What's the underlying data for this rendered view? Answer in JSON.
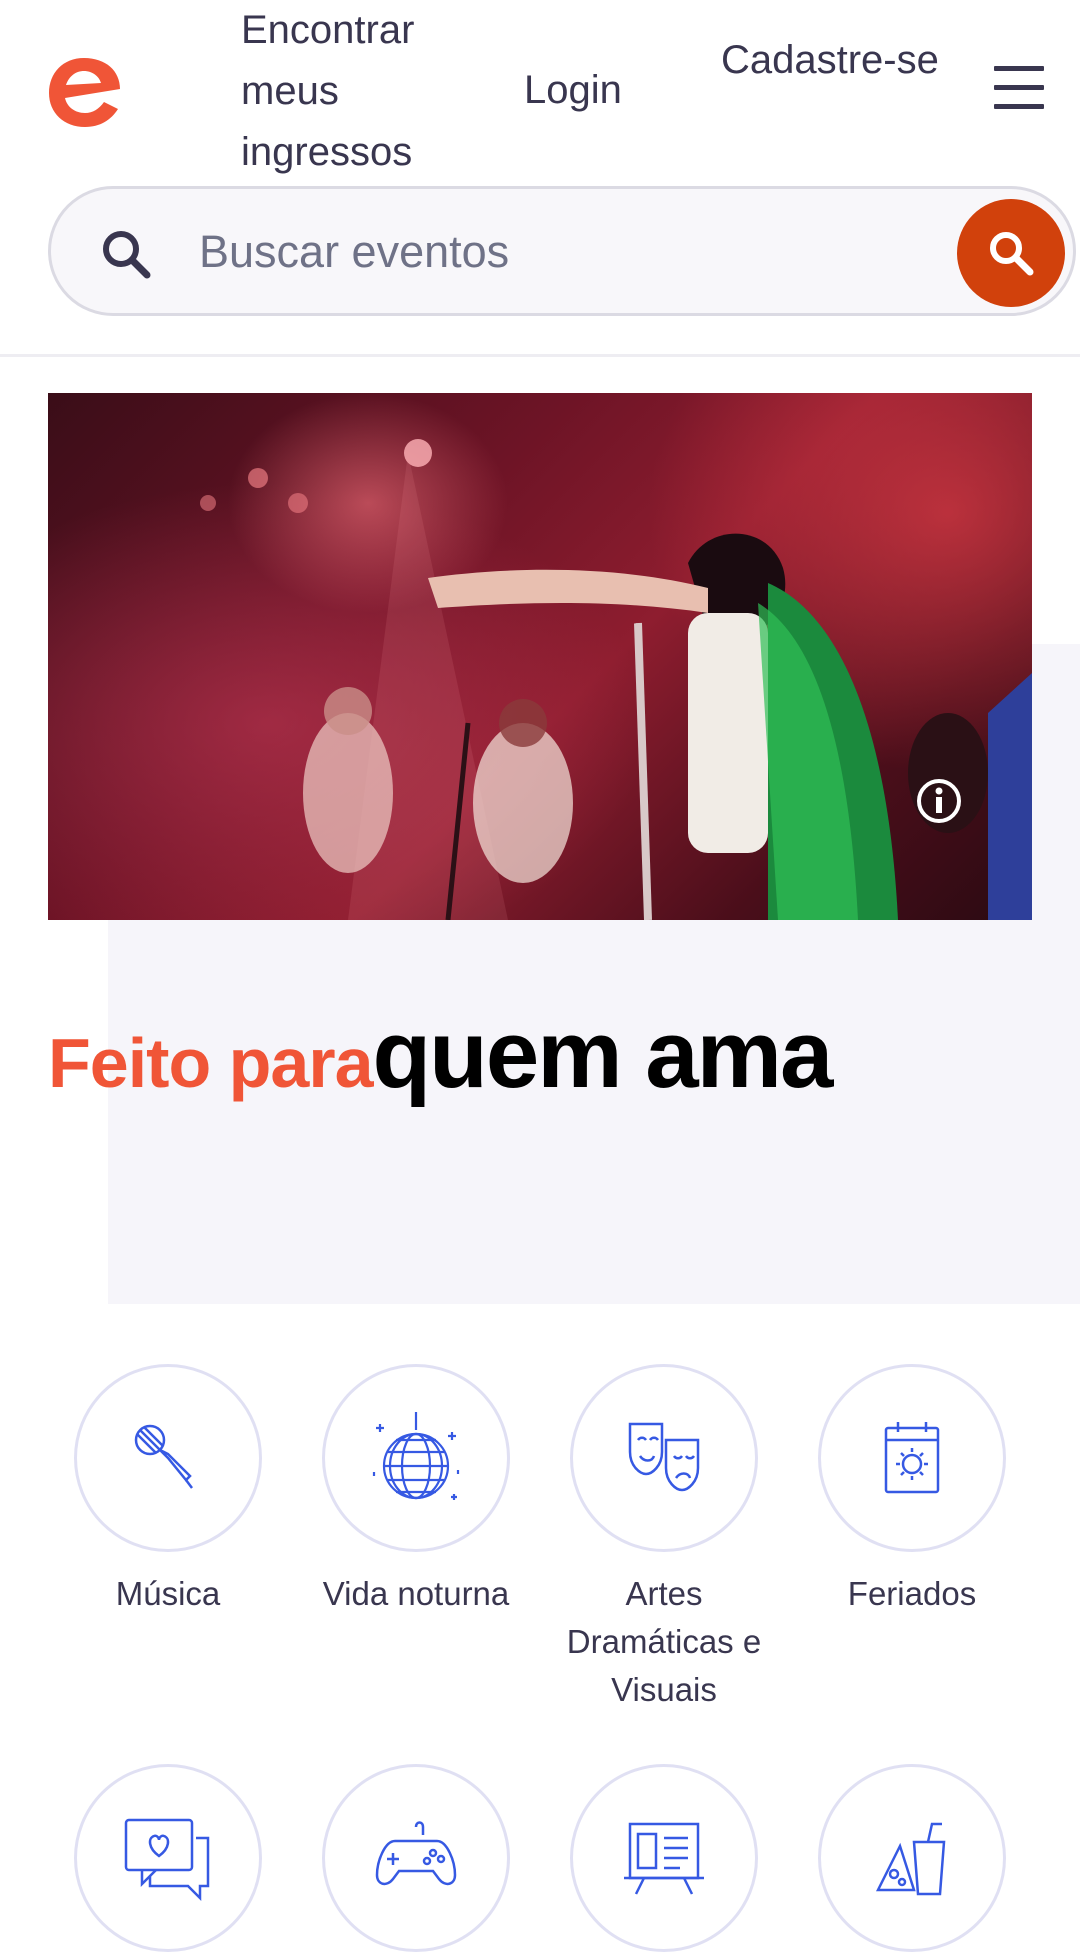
{
  "header": {
    "logo_letter": "e",
    "nav": {
      "find_tickets": "Encontrar meus ingressos",
      "login": "Login",
      "signup": "Cadastre-se"
    }
  },
  "search": {
    "placeholder": "Buscar eventos"
  },
  "hero": {
    "headline_accent": "Feito para",
    "headline_main": "quem ama"
  },
  "categories": [
    {
      "label": "Música",
      "icon": "microphone-icon"
    },
    {
      "label": "Vida noturna",
      "icon": "disco-ball-icon"
    },
    {
      "label": "Artes Dramáticas e Visuais",
      "icon": "theater-masks-icon"
    },
    {
      "label": "Feriados",
      "icon": "calendar-sun-icon"
    },
    {
      "label": "",
      "icon": "chat-heart-icon"
    },
    {
      "label": "",
      "icon": "game-controller-icon"
    },
    {
      "label": "",
      "icon": "presentation-board-icon"
    },
    {
      "label": "",
      "icon": "food-drink-icon"
    }
  ],
  "colors": {
    "brand_orange": "#f05537",
    "search_button": "#d1410c",
    "icon_blue": "#3659e3",
    "text_dark": "#39364f"
  }
}
